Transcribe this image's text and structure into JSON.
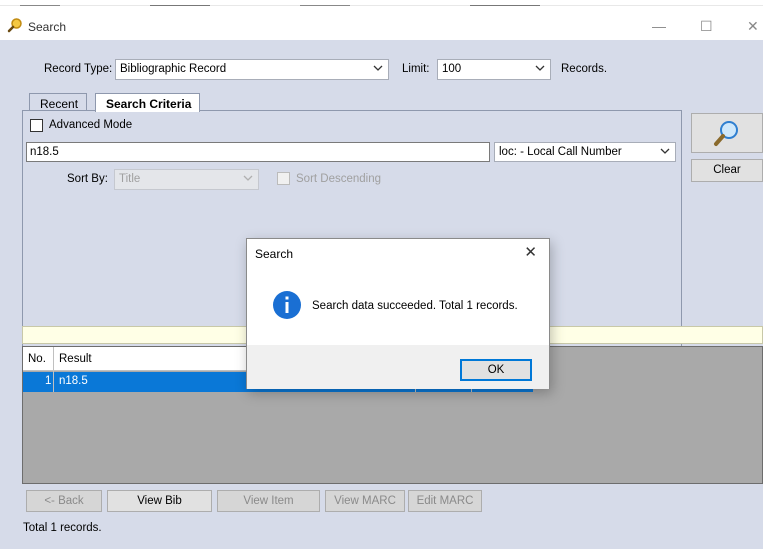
{
  "window": {
    "title": "Search",
    "icon": "magnifier-icon",
    "controls": {
      "minimize": "—",
      "maximize": "☐",
      "close": "✕"
    }
  },
  "search_form": {
    "record_type_label": "Record Type:",
    "record_type_value": "Bibliographic Record",
    "limit_label": "Limit:",
    "limit_value": "100",
    "records_label": "Records."
  },
  "tabs": [
    {
      "label": "Recent",
      "active": false
    },
    {
      "label": "Search Criteria",
      "active": true
    }
  ],
  "criteria": {
    "advanced_mode_label": "Advanced Mode",
    "advanced_mode_checked": false,
    "search_term": "n18.5",
    "index_value": "loc: - Local Call Number",
    "sort_by_label": "Sort By:",
    "sort_by_value": "Title",
    "sort_descending_label": "Sort Descending"
  },
  "side_buttons": {
    "search_icon": "magnifier-icon",
    "clear_label": "Clear"
  },
  "results": {
    "columns": [
      "No.",
      "Result"
    ],
    "rows": [
      {
        "no": "1",
        "result": "n18.5",
        "selected": true
      }
    ]
  },
  "bottom_buttons": {
    "back": "<- Back",
    "view_bib": "View Bib",
    "view_item": "View Item",
    "view_marc": "View MARC",
    "edit_marc": "Edit MARC"
  },
  "status_text": "Total 1 records.",
  "dialog": {
    "title": "Search",
    "close": "✕",
    "icon": "info-icon",
    "message": "Search data succeeded. Total 1 records.",
    "ok_label": "OK"
  },
  "colors": {
    "window_bg": "#d6dbe9",
    "selection": "#0a78d7",
    "info_icon": "#1a6fd3",
    "grid_bg": "#a9a9a9"
  }
}
